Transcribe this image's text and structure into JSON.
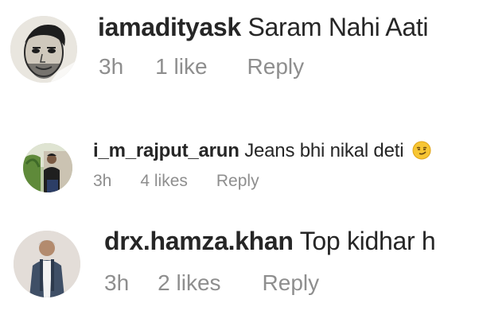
{
  "comments": [
    {
      "username": "iamadityask",
      "text": "Saram Nahi Aati",
      "time": "3h",
      "likes": "1 like",
      "reply": "Reply",
      "emoji": ""
    },
    {
      "username": "i_m_rajput_arun",
      "text": "Jeans bhi nikal deti",
      "time": "3h",
      "likes": "4 likes",
      "reply": "Reply",
      "emoji": "smirking-face-emoji"
    },
    {
      "username": "drx.hamza.khan",
      "text": "Top kidhar h",
      "time": "3h",
      "likes": "2 likes",
      "reply": "Reply",
      "emoji": ""
    }
  ],
  "colors": {
    "username": "#262626",
    "text": "#262626",
    "meta": "#8e8e8e",
    "background": "#ffffff"
  }
}
